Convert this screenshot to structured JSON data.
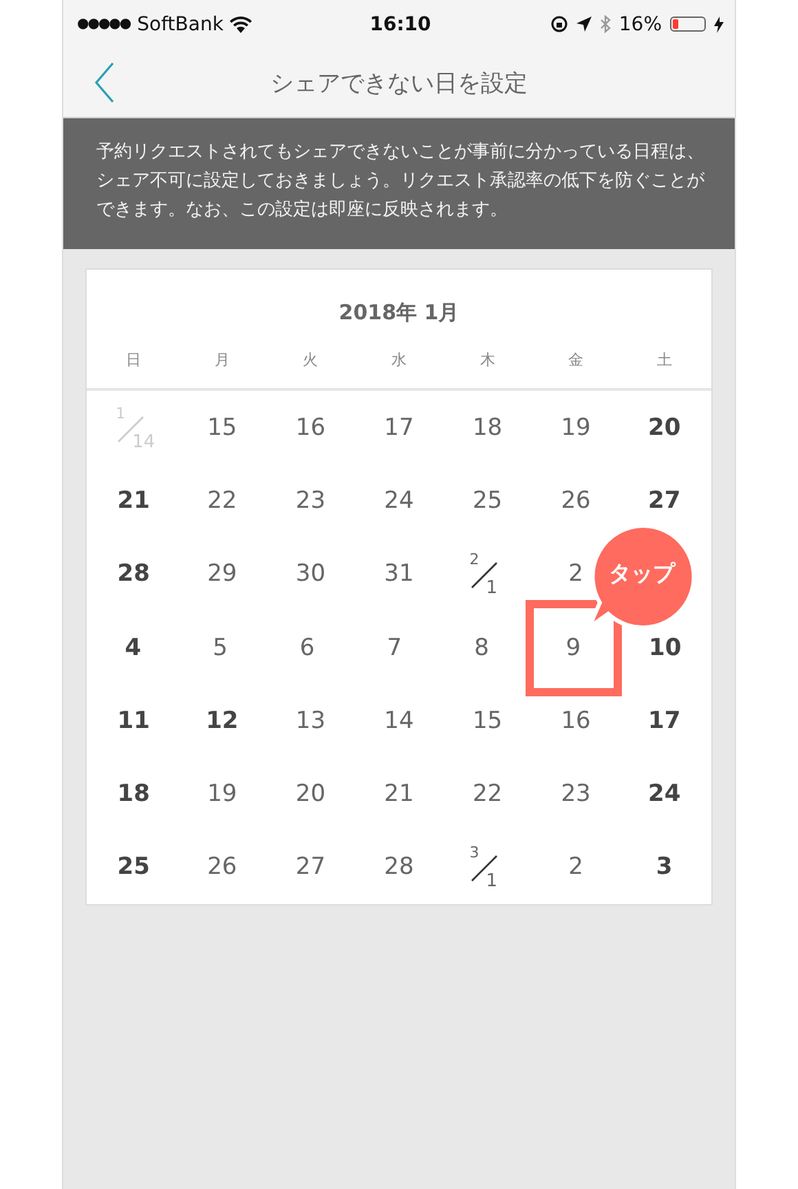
{
  "status_bar": {
    "signal": "●●●●●",
    "carrier": "SoftBank",
    "time": "16:10",
    "battery_percent": "16%",
    "battery": {
      "level": 0.16
    }
  },
  "nav": {
    "title": "シェアできない日を設定"
  },
  "notice": "予約リクエストされてもシェアできないことが事前に分かっている日程は、シェア不可に設定しておきましょう。リクエスト承認率の低下を防ぐことができます。なお、この設定は即座に反映されます。",
  "calendar": {
    "month_title": "2018年 1月",
    "weekdays": [
      "日",
      "月",
      "火",
      "水",
      "木",
      "金",
      "土"
    ],
    "weeks": [
      [
        {
          "kind": "month_start",
          "month": "1",
          "day": "14",
          "bold": false,
          "faded": true,
          "selected": false
        },
        {
          "kind": "day",
          "text": "15",
          "bold": false,
          "faded": false,
          "selected": false
        },
        {
          "kind": "day",
          "text": "16",
          "bold": false,
          "faded": false,
          "selected": false
        },
        {
          "kind": "day",
          "text": "17",
          "bold": false,
          "faded": false,
          "selected": false
        },
        {
          "kind": "day",
          "text": "18",
          "bold": false,
          "faded": false,
          "selected": false
        },
        {
          "kind": "day",
          "text": "19",
          "bold": false,
          "faded": false,
          "selected": false
        },
        {
          "kind": "day",
          "text": "20",
          "bold": true,
          "faded": false,
          "selected": false
        }
      ],
      [
        {
          "kind": "day",
          "text": "21",
          "bold": true,
          "faded": false,
          "selected": false
        },
        {
          "kind": "day",
          "text": "22",
          "bold": false,
          "faded": false,
          "selected": false
        },
        {
          "kind": "day",
          "text": "23",
          "bold": false,
          "faded": false,
          "selected": false
        },
        {
          "kind": "day",
          "text": "24",
          "bold": false,
          "faded": false,
          "selected": false
        },
        {
          "kind": "day",
          "text": "25",
          "bold": false,
          "faded": false,
          "selected": false
        },
        {
          "kind": "day",
          "text": "26",
          "bold": false,
          "faded": false,
          "selected": false
        },
        {
          "kind": "day",
          "text": "27",
          "bold": true,
          "faded": false,
          "selected": false
        }
      ],
      [
        {
          "kind": "day",
          "text": "28",
          "bold": true,
          "faded": false,
          "selected": false
        },
        {
          "kind": "day",
          "text": "29",
          "bold": false,
          "faded": false,
          "selected": false
        },
        {
          "kind": "day",
          "text": "30",
          "bold": false,
          "faded": false,
          "selected": false
        },
        {
          "kind": "day",
          "text": "31",
          "bold": false,
          "faded": false,
          "selected": false
        },
        {
          "kind": "month_start",
          "month": "2",
          "day": "1",
          "bold": false,
          "faded": false,
          "selected": false
        },
        {
          "kind": "day",
          "text": "2",
          "bold": false,
          "faded": false,
          "selected": false
        }
      ],
      [
        {
          "kind": "day",
          "text": "4",
          "bold": true,
          "faded": false,
          "selected": false
        },
        {
          "kind": "day",
          "text": "5",
          "bold": false,
          "faded": false,
          "selected": false
        },
        {
          "kind": "day",
          "text": "6",
          "bold": false,
          "faded": false,
          "selected": false
        },
        {
          "kind": "day",
          "text": "7",
          "bold": false,
          "faded": false,
          "selected": false
        },
        {
          "kind": "day",
          "text": "8",
          "bold": false,
          "faded": false,
          "selected": false
        },
        {
          "kind": "day",
          "text": "9",
          "bold": false,
          "faded": false,
          "selected": true
        },
        {
          "kind": "day",
          "text": "10",
          "bold": true,
          "faded": false,
          "selected": false
        }
      ],
      [
        {
          "kind": "day",
          "text": "11",
          "bold": true,
          "faded": false,
          "selected": false
        },
        {
          "kind": "day",
          "text": "12",
          "bold": true,
          "faded": false,
          "selected": false
        },
        {
          "kind": "day",
          "text": "13",
          "bold": false,
          "faded": false,
          "selected": false
        },
        {
          "kind": "day",
          "text": "14",
          "bold": false,
          "faded": false,
          "selected": false
        },
        {
          "kind": "day",
          "text": "15",
          "bold": false,
          "faded": false,
          "selected": false
        },
        {
          "kind": "day",
          "text": "16",
          "bold": false,
          "faded": false,
          "selected": false
        },
        {
          "kind": "day",
          "text": "17",
          "bold": true,
          "faded": false,
          "selected": false
        }
      ],
      [
        {
          "kind": "day",
          "text": "18",
          "bold": true,
          "faded": false,
          "selected": false
        },
        {
          "kind": "day",
          "text": "19",
          "bold": false,
          "faded": false,
          "selected": false
        },
        {
          "kind": "day",
          "text": "20",
          "bold": false,
          "faded": false,
          "selected": false
        },
        {
          "kind": "day",
          "text": "21",
          "bold": false,
          "faded": false,
          "selected": false
        },
        {
          "kind": "day",
          "text": "22",
          "bold": false,
          "faded": false,
          "selected": false
        },
        {
          "kind": "day",
          "text": "23",
          "bold": false,
          "faded": false,
          "selected": false
        },
        {
          "kind": "day",
          "text": "24",
          "bold": true,
          "faded": false,
          "selected": false
        }
      ],
      [
        {
          "kind": "day",
          "text": "25",
          "bold": true,
          "faded": false,
          "selected": false
        },
        {
          "kind": "day",
          "text": "26",
          "bold": false,
          "faded": false,
          "selected": false
        },
        {
          "kind": "day",
          "text": "27",
          "bold": false,
          "faded": false,
          "selected": false
        },
        {
          "kind": "day",
          "text": "28",
          "bold": false,
          "faded": false,
          "selected": false
        },
        {
          "kind": "month_start",
          "month": "3",
          "day": "1",
          "bold": false,
          "faded": false,
          "selected": false
        },
        {
          "kind": "day",
          "text": "2",
          "bold": false,
          "faded": false,
          "selected": false
        },
        {
          "kind": "day",
          "text": "3",
          "bold": true,
          "faded": false,
          "selected": false
        }
      ]
    ]
  },
  "callout": "タップ"
}
